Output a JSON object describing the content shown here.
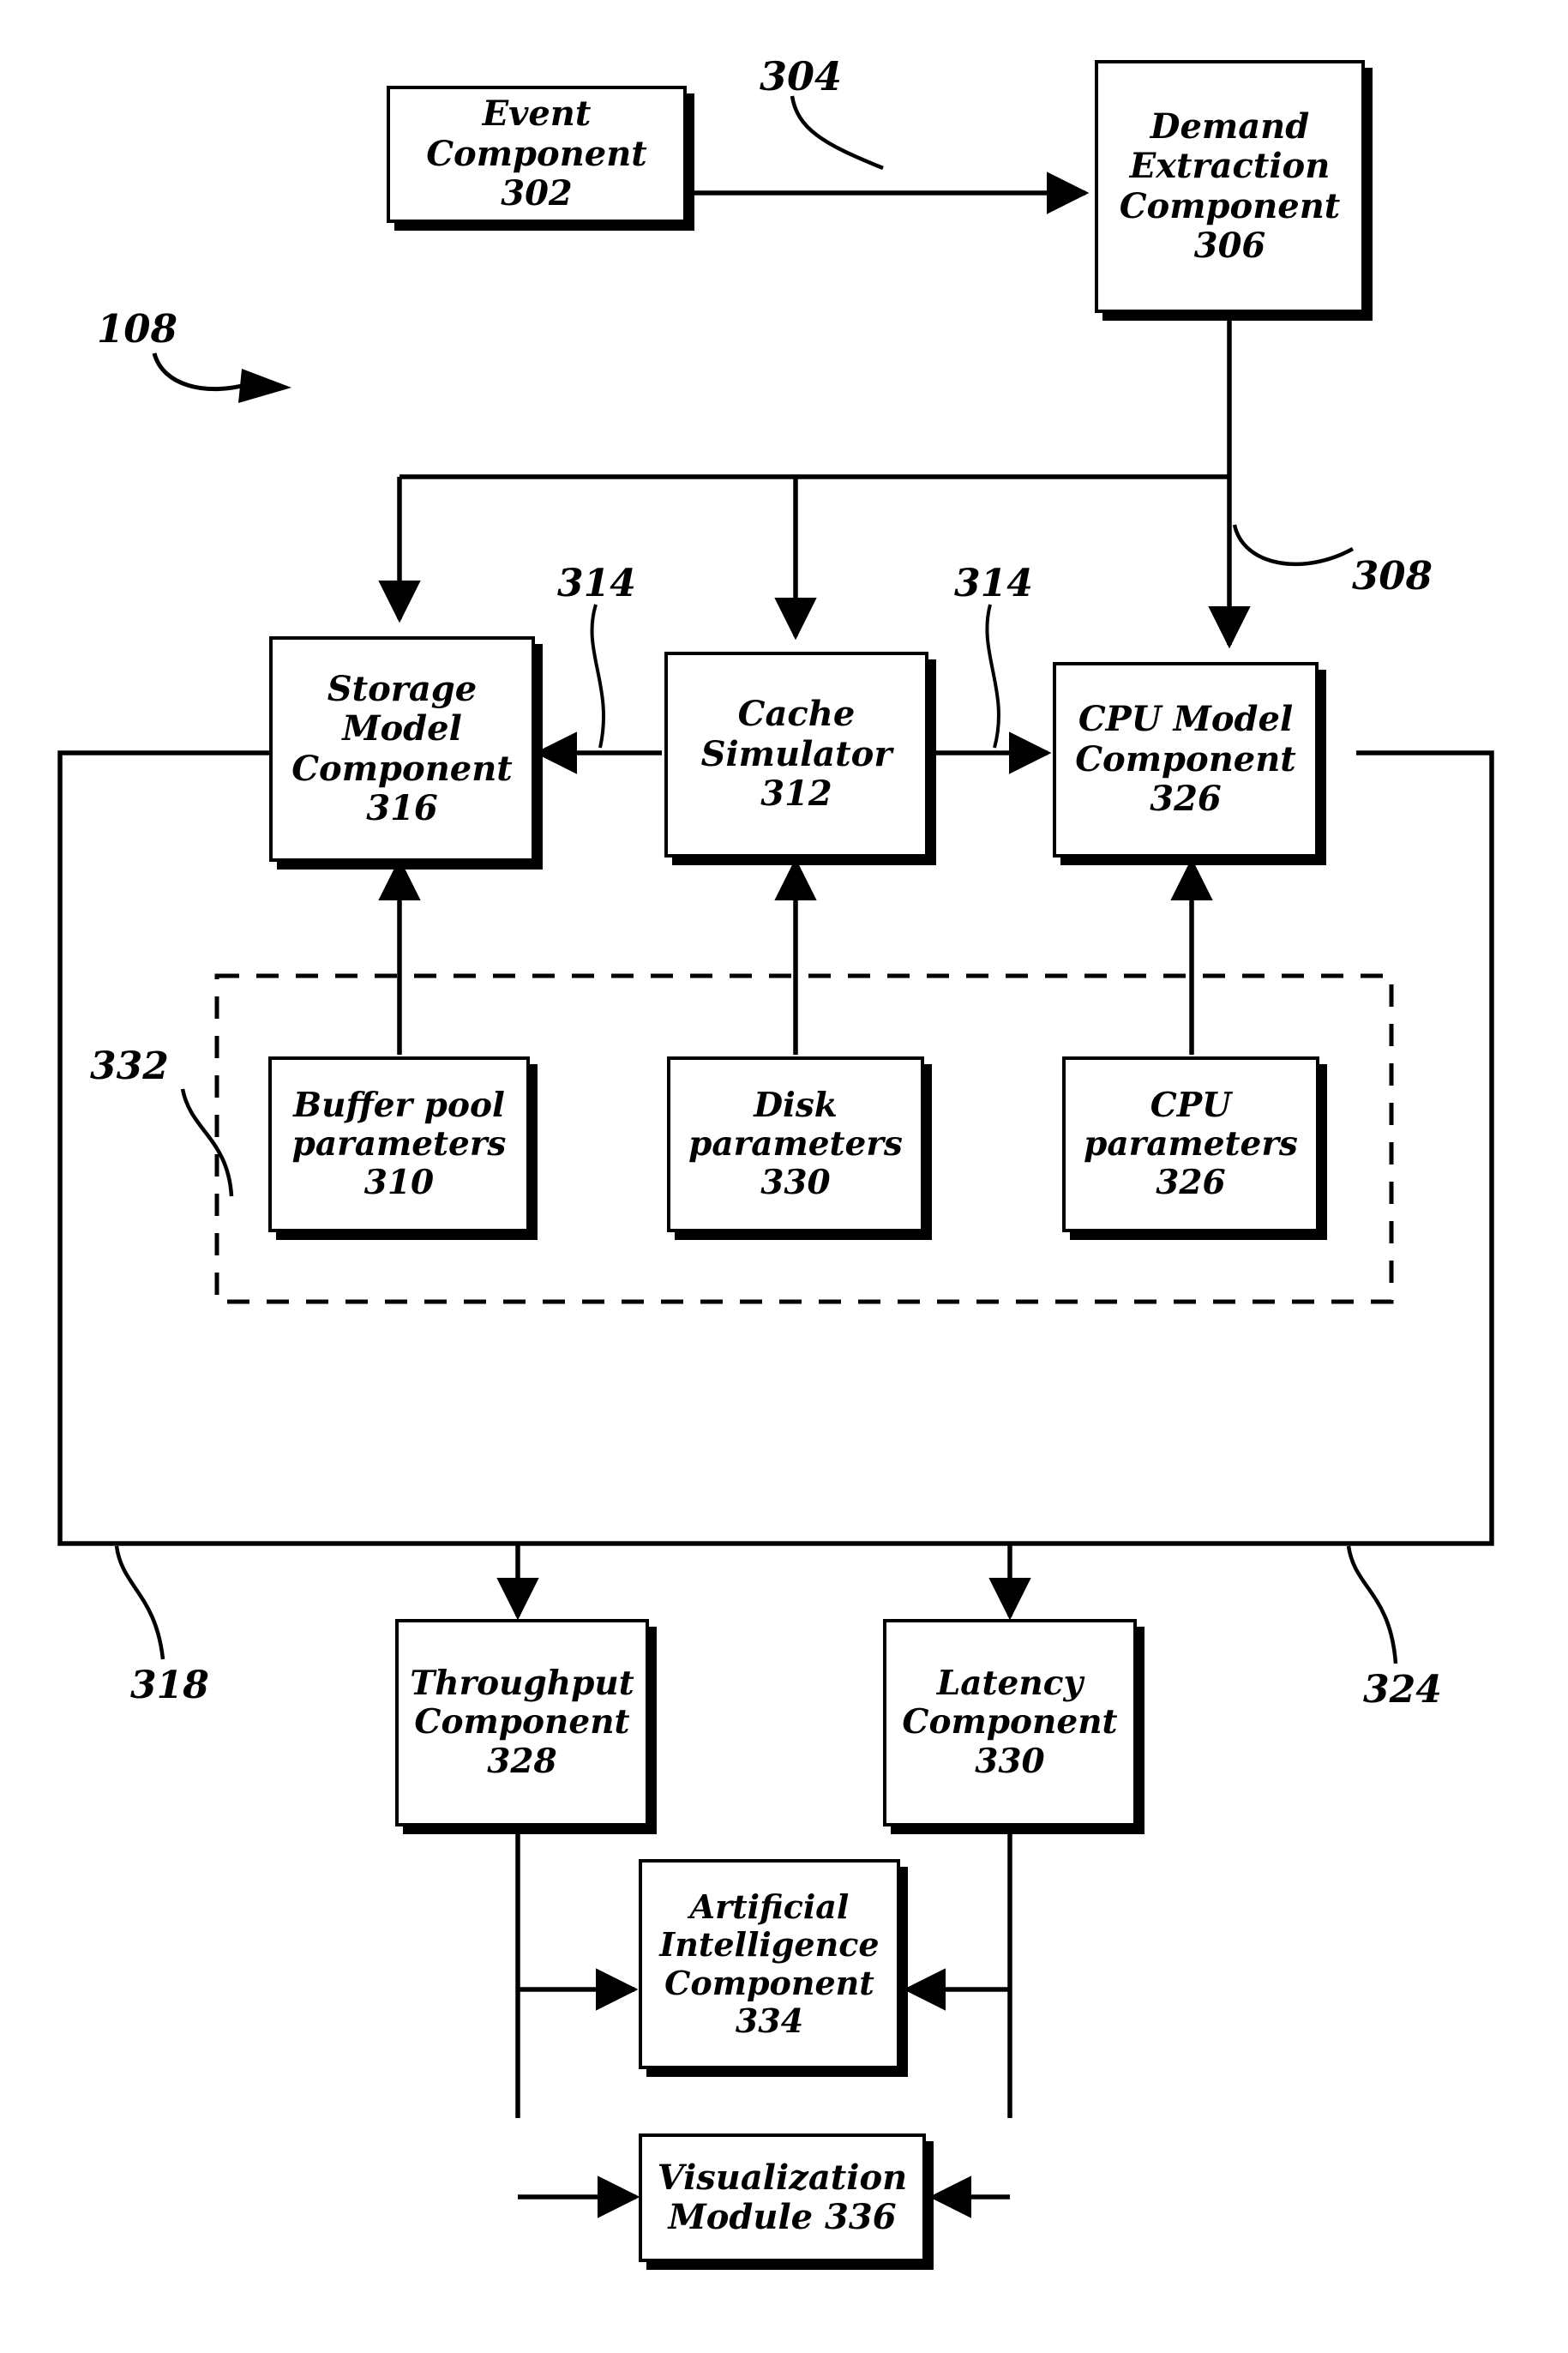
{
  "figure": {
    "kind": "patent-block-diagram",
    "overall_ref": "108",
    "line_color": "#000000",
    "background_color": "#ffffff"
  },
  "nodes": {
    "event": {
      "line1": "Event",
      "line2": "Component",
      "line3": "302"
    },
    "demand": {
      "line1": "Demand",
      "line2": "Extraction",
      "line3": "Component",
      "line4": "306"
    },
    "storage": {
      "line1": "Storage",
      "line2": "Model",
      "line3": "Component",
      "line4": "316"
    },
    "cache": {
      "line1": "Cache",
      "line2": "Simulator",
      "line3": "312"
    },
    "cpu_model": {
      "line1": "CPU Model",
      "line2": "Component",
      "line3": "326"
    },
    "buffer_params": {
      "line1": "Buffer pool",
      "line2": "parameters",
      "line3": "310"
    },
    "disk_params": {
      "line1": "Disk",
      "line2": "parameters",
      "line3": "330"
    },
    "cpu_params": {
      "line1": "CPU",
      "line2": "parameters",
      "line3": "326"
    },
    "throughput": {
      "line1": "Throughput",
      "line2": "Component",
      "line3": "328"
    },
    "latency": {
      "line1": "Latency",
      "line2": "Component",
      "line3": "330"
    },
    "ai": {
      "line1": "Artificial",
      "line2": "Intelligence",
      "line3": "Component",
      "line4": "334"
    },
    "visualization": {
      "line1": "Visualization",
      "line2": "Module 336"
    }
  },
  "refs": {
    "overall": "108",
    "event_to_demand": "304",
    "demand_out": "308",
    "cache_to_storage": "314",
    "cache_to_cpu": "314",
    "params_group": "332",
    "loop_left": "318",
    "loop_right": "324"
  }
}
